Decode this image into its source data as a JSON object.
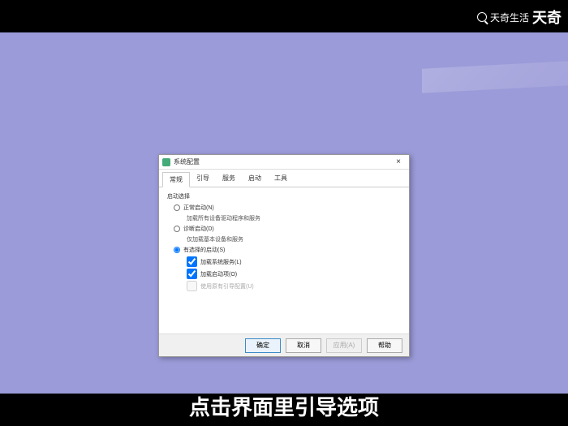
{
  "watermark": {
    "brand": "天奇生活",
    "brand_big": "天奇"
  },
  "subtitle": "点击界面里引导选项",
  "dialog": {
    "title": "系统配置",
    "tabs": [
      "常规",
      "引导",
      "服务",
      "启动",
      "工具"
    ],
    "active_tab": 0,
    "group_title": "启动选择",
    "options": {
      "normal": {
        "label": "正常启动(N)",
        "desc": "加载所有设备驱动程序和服务"
      },
      "diag": {
        "label": "诊断启动(D)",
        "desc": "仅加载基本设备和服务"
      },
      "select": {
        "label": "有选择的启动(S)",
        "chk1": "加载系统服务(L)",
        "chk2": "加载启动项(O)",
        "chk3": "使用原有引导配置(U)"
      }
    },
    "buttons": {
      "ok": "确定",
      "cancel": "取消",
      "apply": "应用(A)",
      "help": "帮助"
    }
  }
}
